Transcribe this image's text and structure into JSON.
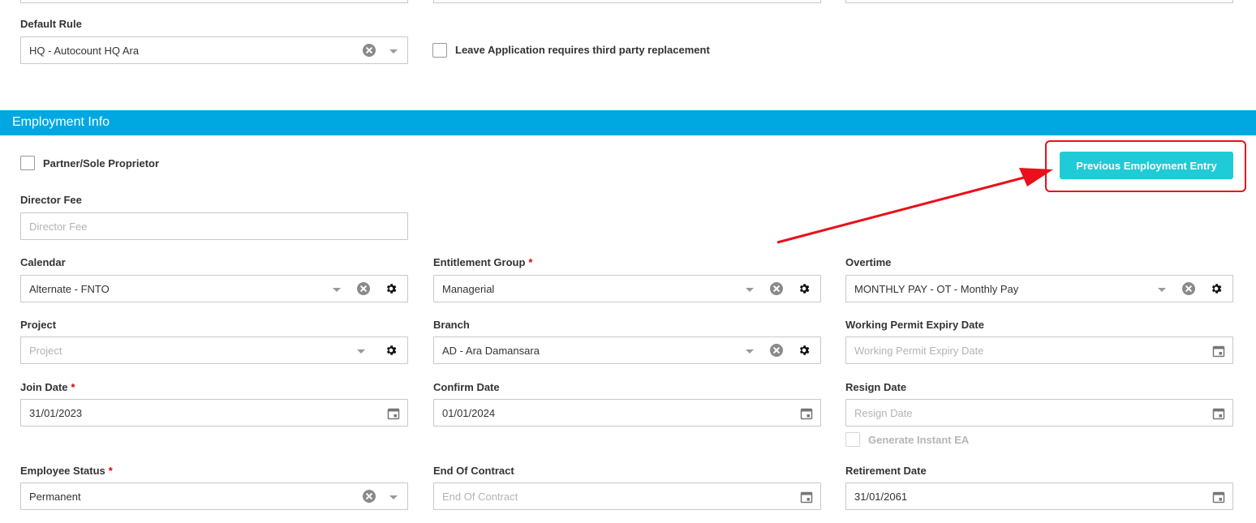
{
  "top": {
    "default_rule": {
      "label": "Default Rule",
      "value": "HQ - Autocount HQ Ara"
    },
    "leave_replacement": {
      "label": "Leave Application requires third party replacement",
      "checked": false
    }
  },
  "section": {
    "title": "Employment Info"
  },
  "partner": {
    "label": "Partner/Sole Proprietor",
    "checked": false
  },
  "previous_employment_button": "Previous Employment Entry",
  "director_fee": {
    "label": "Director Fee",
    "placeholder": "Director Fee"
  },
  "calendar": {
    "label": "Calendar",
    "value": "Alternate - FNTO"
  },
  "entitlement_group": {
    "label": "Entitlement Group",
    "required_mark": "*",
    "value": "Managerial"
  },
  "overtime": {
    "label": "Overtime",
    "value": "MONTHLY PAY - OT - Monthly Pay"
  },
  "project": {
    "label": "Project",
    "placeholder": "Project"
  },
  "branch": {
    "label": "Branch",
    "value": "AD - Ara Damansara"
  },
  "working_permit": {
    "label": "Working Permit Expiry Date",
    "placeholder": "Working Permit Expiry Date"
  },
  "join_date": {
    "label": "Join Date",
    "required_mark": "*",
    "value": "31/01/2023"
  },
  "confirm_date": {
    "label": "Confirm Date",
    "value": "01/01/2024"
  },
  "resign_date": {
    "label": "Resign Date",
    "placeholder": "Resign Date"
  },
  "generate_ea": {
    "label": "Generate Instant EA",
    "checked": false,
    "disabled": true
  },
  "employee_status": {
    "label": "Employee Status",
    "required_mark": "*",
    "value": "Permanent"
  },
  "end_of_contract": {
    "label": "End Of Contract",
    "placeholder": "End Of Contract"
  },
  "retirement_date": {
    "label": "Retirement Date",
    "value": "31/01/2061"
  },
  "colors": {
    "section_bar": "#00a8e1",
    "button": "#1ecbd6",
    "annotation": "#e8101a",
    "required": "#e00000"
  },
  "annotation": {
    "type": "red-arrow-and-box",
    "target": "previous-employment-entry-button"
  }
}
